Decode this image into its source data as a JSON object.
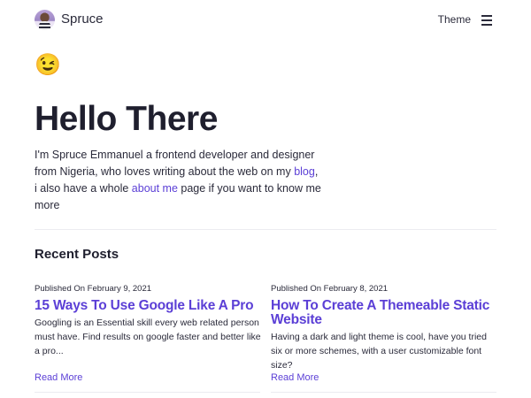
{
  "header": {
    "brand": "Spruce",
    "theme_label": "Theme"
  },
  "hero": {
    "emoji": "😉",
    "title": "Hello There",
    "intro_part1": "I'm Spruce Emmanuel a frontend developer and designer from Nigeria, who loves writing about the web on my ",
    "blog_link": "blog",
    "intro_part2": ", i also have a whole ",
    "about_link": "about me",
    "intro_part3": " page if you want to know me more"
  },
  "recent": {
    "title": "Recent Posts",
    "posts": [
      {
        "date": "Published On February 9, 2021",
        "title": "15 Ways To Use Google Like A Pro",
        "excerpt": "Googling is an Essential skill every web related person must have. Find results on google faster and better like a pro...",
        "read_more": "Read More"
      },
      {
        "date": "Published On February 8, 2021",
        "title": "How To Create A Themeable Static Website",
        "excerpt": "Having a dark and light theme is cool, have you tried six or more schemes, with a user customizable font size?",
        "read_more": "Read More"
      }
    ]
  },
  "colors": {
    "accent": "#5b3fd6",
    "text": "#1f1f2e",
    "background": "#ffffff"
  },
  "icons": {
    "avatar": "profile-avatar",
    "menu": "hamburger-menu-icon"
  }
}
